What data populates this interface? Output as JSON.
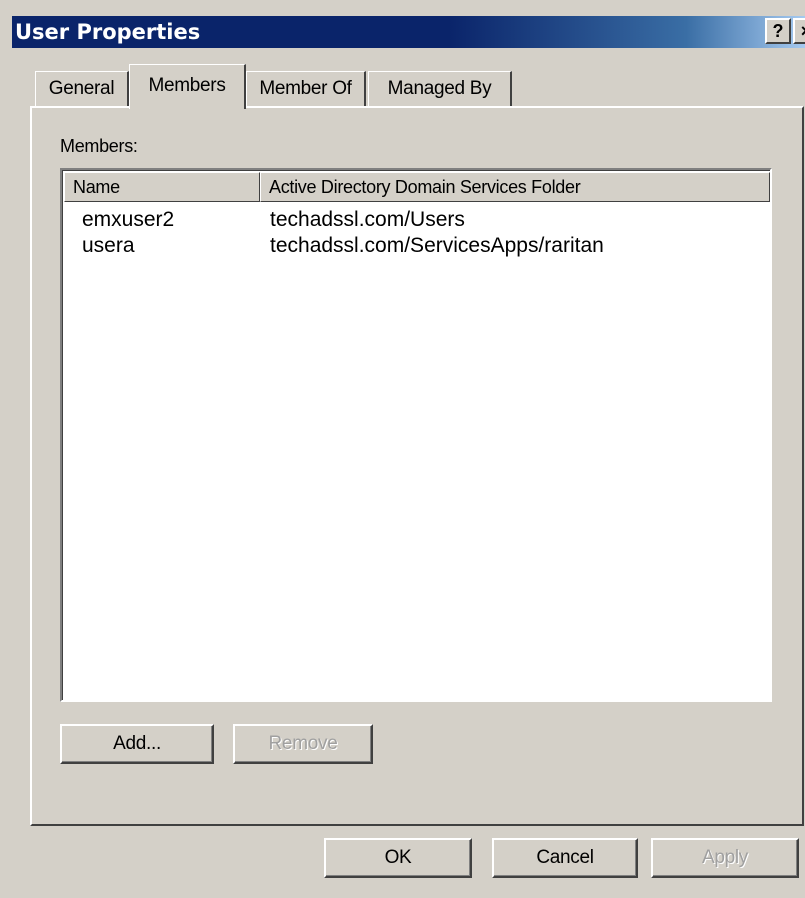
{
  "window": {
    "title": "User Properties",
    "help_button": "?",
    "close_button": "×"
  },
  "tabs": [
    {
      "label": "General",
      "active": false
    },
    {
      "label": "Members",
      "active": true
    },
    {
      "label": "Member Of",
      "active": false
    },
    {
      "label": "Managed By",
      "active": false
    }
  ],
  "members": {
    "label": "Members:",
    "columns": [
      "Name",
      "Active Directory Domain Services Folder"
    ],
    "rows": [
      {
        "name": "emxuser2",
        "folder": "techadssl.com/Users"
      },
      {
        "name": "usera",
        "folder": "techadssl.com/ServicesApps/raritan"
      }
    ],
    "add_button": "Add...",
    "remove_button": "Remove"
  },
  "footer": {
    "ok": "OK",
    "cancel": "Cancel",
    "apply": "Apply"
  },
  "colors": {
    "titlebar_start": "#0a246a",
    "titlebar_end": "#a6caf0",
    "face": "#d4d0c8"
  }
}
